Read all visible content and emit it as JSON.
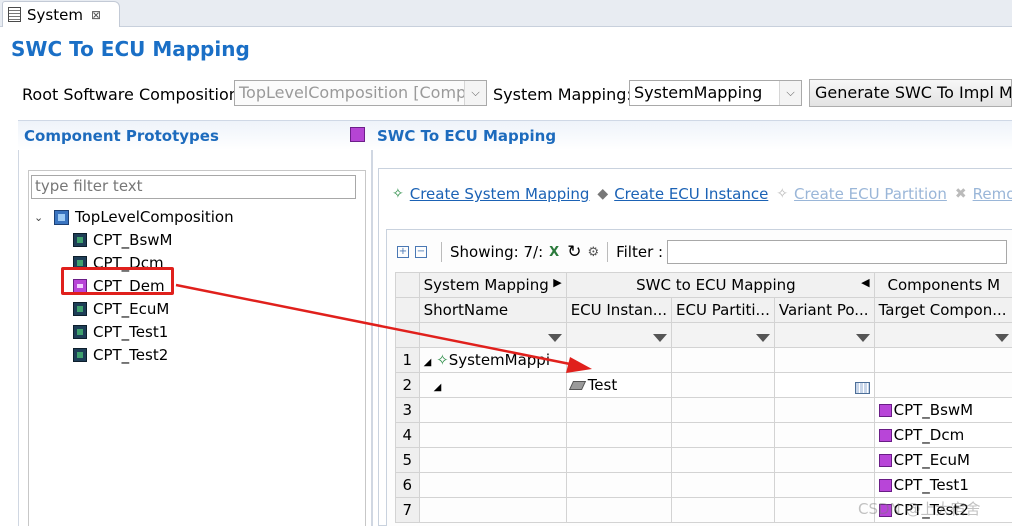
{
  "tab": {
    "label": "System",
    "close": "⊠"
  },
  "page_title": "SWC To ECU Mapping",
  "root": {
    "label": "Root Software Composition:",
    "value": "TopLevelComposition [Compo",
    "system_mapping_label": "System Mapping:",
    "system_mapping_value": "SystemMapping",
    "generate_button": "Generate SWC To Impl Map"
  },
  "left_panel": {
    "title": "Component Prototypes",
    "filter_placeholder": "type filter text",
    "root_node": "TopLevelComposition",
    "items": [
      "CPT_BswM",
      "CPT_Dcm",
      "CPT_Dem",
      "CPT_EcuM",
      "CPT_Test1",
      "CPT_Test2"
    ]
  },
  "right_panel": {
    "title": "SWC To ECU Mapping",
    "toolbar": {
      "create_system_mapping": "Create System Mapping",
      "create_ecu_instance": "Create ECU Instance",
      "create_ecu_partition": "Create ECU Partition",
      "remove": "Remo"
    },
    "grid_toolbar": {
      "showing": "Showing: 7/:",
      "filter_label": "Filter :"
    },
    "group_headers": [
      "System Mapping",
      "SWC to ECU Mapping",
      "Components M"
    ],
    "columns": [
      "ShortName",
      "ECU Instan...",
      "ECU Partiti...",
      "Variant Po...",
      "Target Compon..."
    ],
    "rows": [
      {
        "num": "1",
        "short": "SystemMappi",
        "ecu": "",
        "target": ""
      },
      {
        "num": "2",
        "short": "",
        "ecu": "Test",
        "target": ""
      },
      {
        "num": "3",
        "short": "",
        "ecu": "",
        "target": "CPT_BswM"
      },
      {
        "num": "4",
        "short": "",
        "ecu": "",
        "target": "CPT_Dcm"
      },
      {
        "num": "5",
        "short": "",
        "ecu": "",
        "target": "CPT_EcuM"
      },
      {
        "num": "6",
        "short": "",
        "ecu": "",
        "target": "CPT_Test1"
      },
      {
        "num": "7",
        "short": "",
        "ecu": "",
        "target": "CPT_Test2"
      }
    ]
  },
  "watermark": "CSDN @上大宿舍"
}
